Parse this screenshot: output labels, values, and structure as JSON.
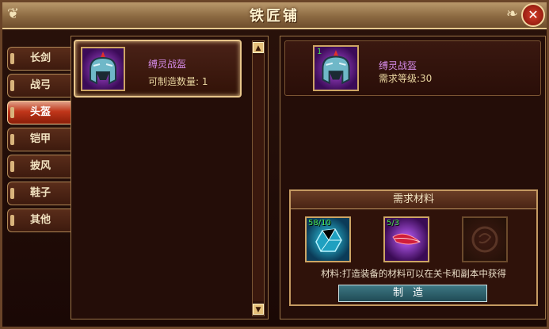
{
  "window": {
    "title": "铁匠铺",
    "close_glyph": "✕",
    "colors": {
      "frame": "#6a4428",
      "accent": "#e8c68b",
      "active_tab": "#c0361a",
      "item_name": "#d48ae6",
      "material_count": "#49e24d"
    }
  },
  "tabs": [
    {
      "label": "长剑",
      "active": false
    },
    {
      "label": "战弓",
      "active": false
    },
    {
      "label": "头盔",
      "active": true
    },
    {
      "label": "铠甲",
      "active": false
    },
    {
      "label": "披风",
      "active": false
    },
    {
      "label": "鞋子",
      "active": false
    },
    {
      "label": "其他",
      "active": false
    }
  ],
  "list": {
    "items": [
      {
        "name": "缚灵战盔",
        "count_label": "可制造数量:",
        "count_value": "1",
        "icon": "helmet-icon"
      }
    ],
    "scroll_up_glyph": "▲",
    "scroll_down_glyph": "▼"
  },
  "detail": {
    "badge": "1",
    "name": "缚灵战盔",
    "requirement": "需求等级:30",
    "icon": "helmet-icon"
  },
  "materials": {
    "title": "需求材料",
    "slots": [
      {
        "count": "58/10",
        "icon": "crystal-ore-icon"
      },
      {
        "count": "5/3",
        "icon": "red-feather-icon"
      },
      {
        "count": "",
        "icon": "empty-slot-icon"
      }
    ],
    "hint": "材料:打造装备的材料可以在关卡和副本中获得",
    "craft_label": "制造"
  }
}
